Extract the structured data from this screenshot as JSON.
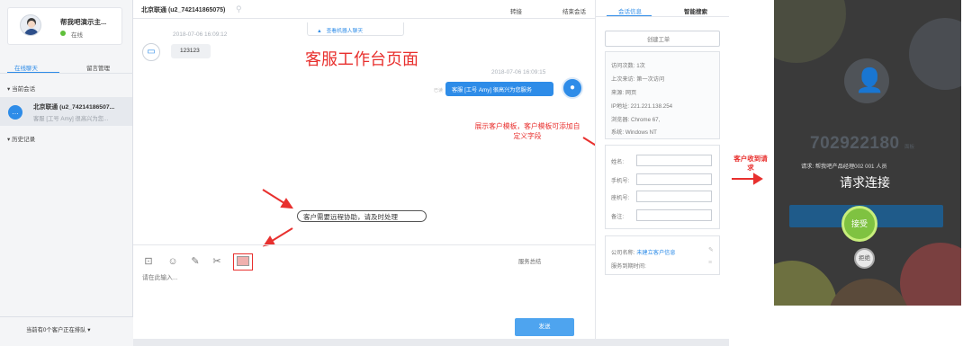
{
  "sidebar": {
    "agent_name": "帮我吧演示主...",
    "status": "在线",
    "tab_online": "在线聊天",
    "tab_message": "留言管理",
    "section_current": "▾  当前会话",
    "session_name": "北京联通 (u2_74214186507...",
    "session_preview": "客服 [工号 Amy] 很高兴为您...",
    "section_history": "▾  历史记录",
    "queue_text": "当前有0个客户正在排队  ▾"
  },
  "chat": {
    "title": "北京联通 (u2_742141865075)",
    "transfer": "转接",
    "end_chat": "结束会话",
    "robot_notice": "查看机器人聊天",
    "time1": "2018-07-06 16:09:12",
    "visitor_msg": "123123",
    "page_title": "客服工作台页面",
    "time2": "2018-07-06 16:09:15",
    "read_flag": "已读",
    "agent_msg": "客服 [工号 Amy] 很高兴为您服务",
    "annotation_template": "展示客户模板，客户模板可添加自定义字段",
    "annotation_remote": "客户需要远程协助，请及时处理",
    "input_placeholder": "请在此输入...",
    "service_summary": "服务总结",
    "send": "发送"
  },
  "info": {
    "tab_session": "会话信息",
    "tab_search": "智能搜索",
    "create_order": "创建工单",
    "lines": [
      "访问次数: 1次",
      "上次来访: 第一次访问",
      "来源: 网页",
      "IP地址: 221.221.138.254",
      "浏览器: Chrome 67,",
      "系统: Windows NT"
    ],
    "form_labels": [
      "姓名:",
      "手机号:",
      "座机号:",
      "备注:"
    ],
    "company_label": "公司名称:",
    "company_link": "未建立客户信息",
    "service_time": "服务到期时间:"
  },
  "annotation_request": "客户收到请求",
  "phone": {
    "id": "702922180",
    "id_tag": "面板",
    "org": "请求: 帮我吧产品经理002 001 人员",
    "title": "请求连接",
    "accept": "接受",
    "reject": "拒绝"
  }
}
